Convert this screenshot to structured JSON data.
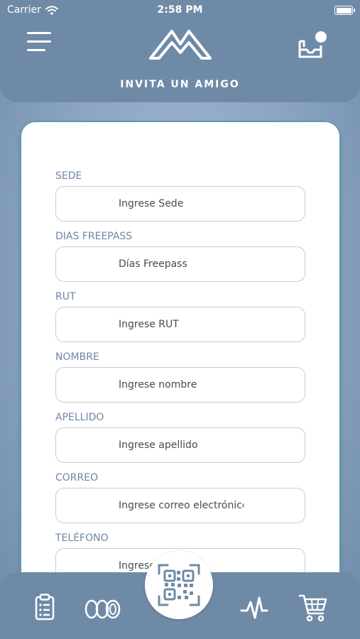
{
  "status_bar": {
    "carrier": "Carrier",
    "time": "2:58 PM"
  },
  "header": {
    "title": "INVITA UN AMIGO"
  },
  "form": {
    "fields": [
      {
        "label": "SEDE",
        "placeholder": "Ingrese Sede"
      },
      {
        "label": "DIAS FREEPASS",
        "placeholder": "Días Freepass"
      },
      {
        "label": "RUT",
        "placeholder": "Ingrese RUT"
      },
      {
        "label": "NOMBRE",
        "placeholder": "Ingrese nombre"
      },
      {
        "label": "APELLIDO",
        "placeholder": "Ingrese apellido"
      },
      {
        "label": "CORREO",
        "placeholder": "Ingrese correo electrónico"
      },
      {
        "label": "TELÉFONO",
        "placeholder": "Ingrese móvil"
      }
    ]
  },
  "bottom_nav": {
    "items": [
      {
        "icon": "clipboard-icon"
      },
      {
        "icon": "membership-rings-icon"
      },
      {
        "icon": "qr-code-icon"
      },
      {
        "icon": "activity-pulse-icon"
      },
      {
        "icon": "shopping-cart-icon"
      }
    ]
  },
  "colors": {
    "header_bg": "#6f8aa6",
    "label": "#6e87a8",
    "card_border": "#5d99b3"
  }
}
